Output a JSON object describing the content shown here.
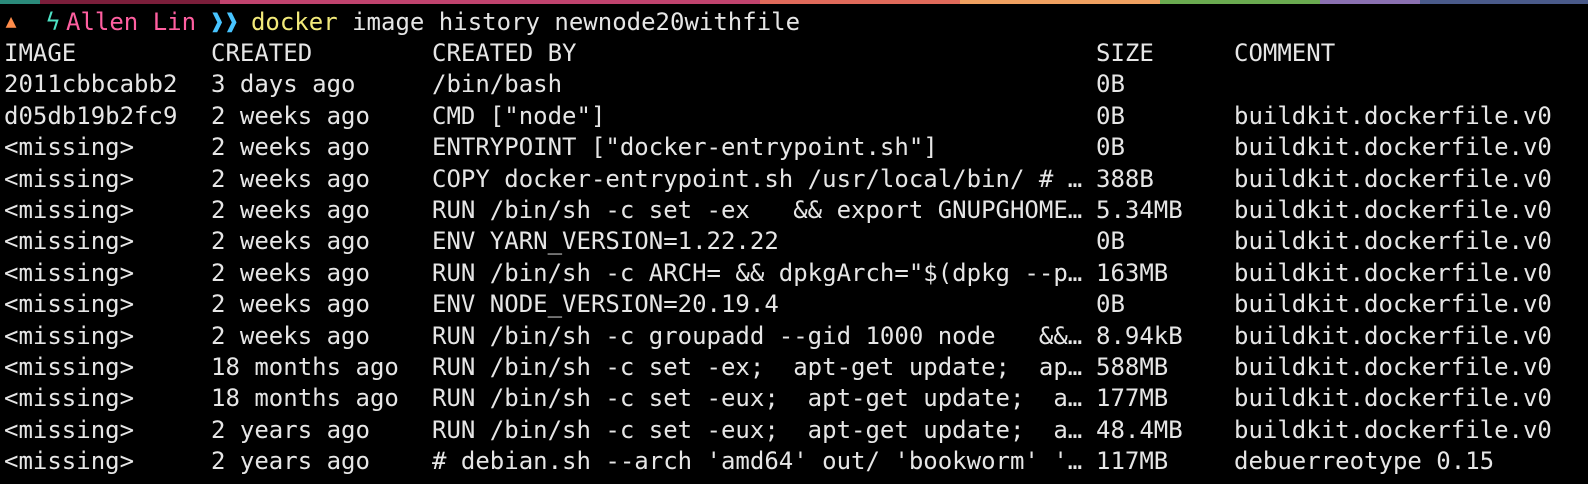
{
  "prompt": {
    "user": "Allen Lin",
    "arrows": "❱❱",
    "command": "docker",
    "arguments": "image history newnode20withfile"
  },
  "colors": {
    "background": "#000000",
    "foreground": "#e6e6e6",
    "user": "#ff5fa0",
    "arrows": "#47c4ff",
    "command": "#f2ea7a",
    "bolt": "#4de2c4",
    "flame": "#ff8c4a"
  },
  "icons": {
    "prompt_start": "flame-icon",
    "prompt_user": "bolt-icon"
  },
  "table": {
    "headers": [
      "IMAGE",
      "CREATED",
      "CREATED BY",
      "SIZE",
      "COMMENT"
    ],
    "rows": [
      [
        "2011cbbcabb2",
        "3 days ago",
        "/bin/bash",
        "0B",
        ""
      ],
      [
        "d05db19b2fc9",
        "2 weeks ago",
        "CMD [\"node\"]",
        "0B",
        "buildkit.dockerfile.v0"
      ],
      [
        "<missing>",
        "2 weeks ago",
        "ENTRYPOINT [\"docker-entrypoint.sh\"]",
        "0B",
        "buildkit.dockerfile.v0"
      ],
      [
        "<missing>",
        "2 weeks ago",
        "COPY docker-entrypoint.sh /usr/local/bin/ # …",
        "388B",
        "buildkit.dockerfile.v0"
      ],
      [
        "<missing>",
        "2 weeks ago",
        "RUN /bin/sh -c set -ex   && export GNUPGHOME…",
        "5.34MB",
        "buildkit.dockerfile.v0"
      ],
      [
        "<missing>",
        "2 weeks ago",
        "ENV YARN_VERSION=1.22.22",
        "0B",
        "buildkit.dockerfile.v0"
      ],
      [
        "<missing>",
        "2 weeks ago",
        "RUN /bin/sh -c ARCH= && dpkgArch=\"$(dpkg --p…",
        "163MB",
        "buildkit.dockerfile.v0"
      ],
      [
        "<missing>",
        "2 weeks ago",
        "ENV NODE_VERSION=20.19.4",
        "0B",
        "buildkit.dockerfile.v0"
      ],
      [
        "<missing>",
        "2 weeks ago",
        "RUN /bin/sh -c groupadd --gid 1000 node   &&…",
        "8.94kB",
        "buildkit.dockerfile.v0"
      ],
      [
        "<missing>",
        "18 months ago",
        "RUN /bin/sh -c set -ex;  apt-get update;  ap…",
        "588MB",
        "buildkit.dockerfile.v0"
      ],
      [
        "<missing>",
        "18 months ago",
        "RUN /bin/sh -c set -eux;  apt-get update;  a…",
        "177MB",
        "buildkit.dockerfile.v0"
      ],
      [
        "<missing>",
        "2 years ago",
        "RUN /bin/sh -c set -eux;  apt-get update;  a…",
        "48.4MB",
        "buildkit.dockerfile.v0"
      ],
      [
        "<missing>",
        "2 years ago",
        "# debian.sh --arch 'amd64' out/ 'bookworm' '…",
        "117MB",
        "debuerreotype 0.15"
      ]
    ]
  }
}
